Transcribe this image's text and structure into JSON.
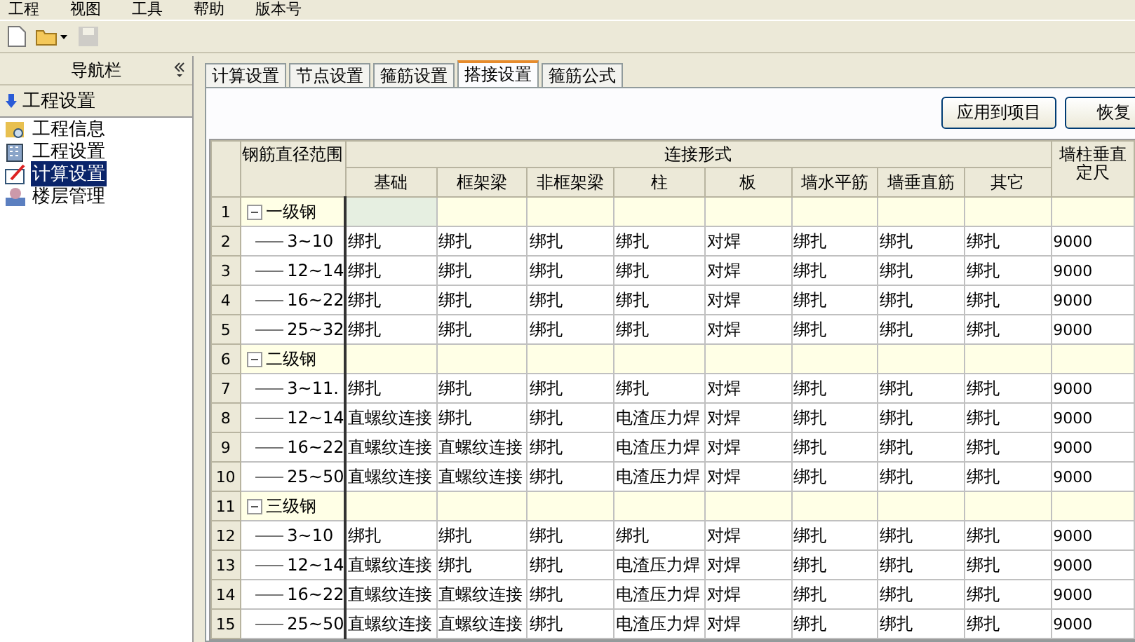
{
  "menu": [
    "工程",
    "视图",
    "工具",
    "帮助",
    "版本号"
  ],
  "toolbar": [
    {
      "kind": "new",
      "disabled": false
    },
    {
      "kind": "open",
      "disabled": false
    },
    {
      "kind": "save",
      "disabled": true
    }
  ],
  "sidebar": {
    "title": "导航栏",
    "section": "工程设置",
    "items": [
      {
        "label": "工程信息",
        "kind": "info",
        "selected": false
      },
      {
        "label": "工程设置",
        "kind": "settings",
        "selected": false
      },
      {
        "label": "计算设置",
        "kind": "calc",
        "selected": true
      },
      {
        "label": "楼层管理",
        "kind": "floors",
        "selected": false
      }
    ]
  },
  "tabs": [
    {
      "label": "计算设置",
      "selected": false
    },
    {
      "label": "节点设置",
      "selected": false
    },
    {
      "label": "箍筋设置",
      "selected": false
    },
    {
      "label": "搭接设置",
      "selected": true
    },
    {
      "label": "箍筋公式",
      "selected": false
    }
  ],
  "buttons": [
    "应用到项目",
    "恢复"
  ],
  "table": {
    "range_header": "钢筋直径范围",
    "group_header": "连接形式",
    "columns": [
      "基础",
      "框架梁",
      "非框架梁",
      "柱",
      "板",
      "墙水平筋",
      "墙垂直筋",
      "其它"
    ],
    "last_column_lines": [
      "墙柱垂直",
      "定尺"
    ],
    "groups": [
      {
        "num": "1",
        "label": "一级钢",
        "expanded": true,
        "children": [
          {
            "num": "2",
            "range": "3~10",
            "cells": [
              "绑扎",
              "绑扎",
              "绑扎",
              "绑扎",
              "对焊",
              "绑扎",
              "绑扎",
              "绑扎",
              "9000"
            ]
          },
          {
            "num": "3",
            "range": "12~14",
            "cells": [
              "绑扎",
              "绑扎",
              "绑扎",
              "绑扎",
              "对焊",
              "绑扎",
              "绑扎",
              "绑扎",
              "9000"
            ]
          },
          {
            "num": "4",
            "range": "16~22",
            "cells": [
              "绑扎",
              "绑扎",
              "绑扎",
              "绑扎",
              "对焊",
              "绑扎",
              "绑扎",
              "绑扎",
              "9000"
            ]
          },
          {
            "num": "5",
            "range": "25~32",
            "cells": [
              "绑扎",
              "绑扎",
              "绑扎",
              "绑扎",
              "对焊",
              "绑扎",
              "绑扎",
              "绑扎",
              "9000"
            ]
          }
        ]
      },
      {
        "num": "6",
        "label": "二级钢",
        "expanded": true,
        "children": [
          {
            "num": "7",
            "range": "3~11.",
            "cells": [
              "绑扎",
              "绑扎",
              "绑扎",
              "绑扎",
              "对焊",
              "绑扎",
              "绑扎",
              "绑扎",
              "9000"
            ]
          },
          {
            "num": "8",
            "range": "12~14",
            "cells": [
              "直螺纹连接",
              "绑扎",
              "绑扎",
              "电渣压力焊",
              "对焊",
              "绑扎",
              "绑扎",
              "绑扎",
              "9000"
            ]
          },
          {
            "num": "9",
            "range": "16~22",
            "cells": [
              "直螺纹连接",
              "直螺纹连接",
              "绑扎",
              "电渣压力焊",
              "对焊",
              "绑扎",
              "绑扎",
              "绑扎",
              "9000"
            ]
          },
          {
            "num": "10",
            "range": "25~50",
            "cells": [
              "直螺纹连接",
              "直螺纹连接",
              "绑扎",
              "电渣压力焊",
              "对焊",
              "绑扎",
              "绑扎",
              "绑扎",
              "9000"
            ]
          }
        ]
      },
      {
        "num": "11",
        "label": "三级钢",
        "expanded": true,
        "children": [
          {
            "num": "12",
            "range": "3~10",
            "cells": [
              "绑扎",
              "绑扎",
              "绑扎",
              "绑扎",
              "对焊",
              "绑扎",
              "绑扎",
              "绑扎",
              "9000"
            ]
          },
          {
            "num": "13",
            "range": "12~14",
            "cells": [
              "直螺纹连接",
              "绑扎",
              "绑扎",
              "电渣压力焊",
              "对焊",
              "绑扎",
              "绑扎",
              "绑扎",
              "9000"
            ]
          },
          {
            "num": "14",
            "range": "16~22",
            "cells": [
              "直螺纹连接",
              "直螺纹连接",
              "绑扎",
              "电渣压力焊",
              "对焊",
              "绑扎",
              "绑扎",
              "绑扎",
              "9000"
            ]
          },
          {
            "num": "15",
            "range": "25~50",
            "cells": [
              "直螺纹连接",
              "直螺纹连接",
              "绑扎",
              "电渣压力焊",
              "对焊",
              "绑扎",
              "绑扎",
              "绑扎",
              "9000"
            ]
          }
        ]
      }
    ]
  }
}
